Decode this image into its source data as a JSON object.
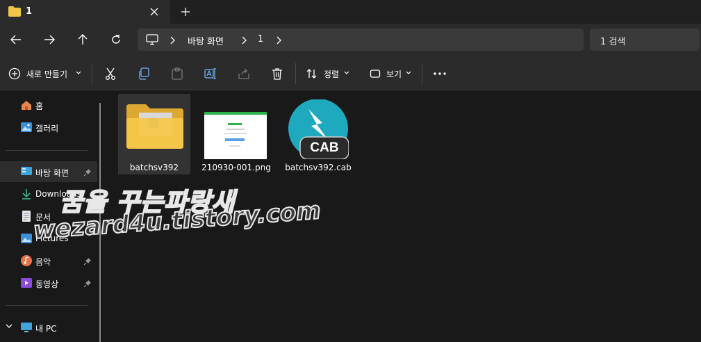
{
  "window": {
    "tab_title": "1",
    "close_tab": "close-tab",
    "new_tab": "new-tab"
  },
  "nav": {
    "breadcrumb": [
      "바탕 화면",
      "1"
    ],
    "search_placeholder": "1 검색"
  },
  "toolbar": {
    "new_label": "새로 만들기",
    "sort_label": "정렬",
    "view_label": "보기"
  },
  "sidebar": {
    "items": [
      {
        "label": "홈",
        "icon": "home-icon",
        "pinned": false
      },
      {
        "label": "갤러리",
        "icon": "gallery-icon",
        "pinned": false
      },
      {
        "label": "바탕 화면",
        "icon": "desktop-icon",
        "pinned": true,
        "selected": true
      },
      {
        "label": "Downloads",
        "icon": "download-icon",
        "pinned": true
      },
      {
        "label": "문서",
        "icon": "document-icon",
        "pinned": true
      },
      {
        "label": "Pictures",
        "icon": "pictures-icon",
        "pinned": true
      },
      {
        "label": "음악",
        "icon": "music-icon",
        "pinned": true
      },
      {
        "label": "동영상",
        "icon": "video-icon",
        "pinned": true
      },
      {
        "label": "내 PC",
        "icon": "pc-icon",
        "pinned": false
      }
    ]
  },
  "files": [
    {
      "name": "batchsv392",
      "type": "folder",
      "selected": true
    },
    {
      "name": "210930-001.png",
      "type": "image"
    },
    {
      "name": "batchsv392.cab",
      "type": "cab",
      "badge": "CAB"
    }
  ],
  "watermark": {
    "line1": "꿈을 꾸는파랑새",
    "line2": "wezard4u.tistory.com"
  },
  "colors": {
    "folder": "#f0c64a",
    "cab_circle": "#1fa9bf",
    "accent_png": "#2bb24c"
  }
}
